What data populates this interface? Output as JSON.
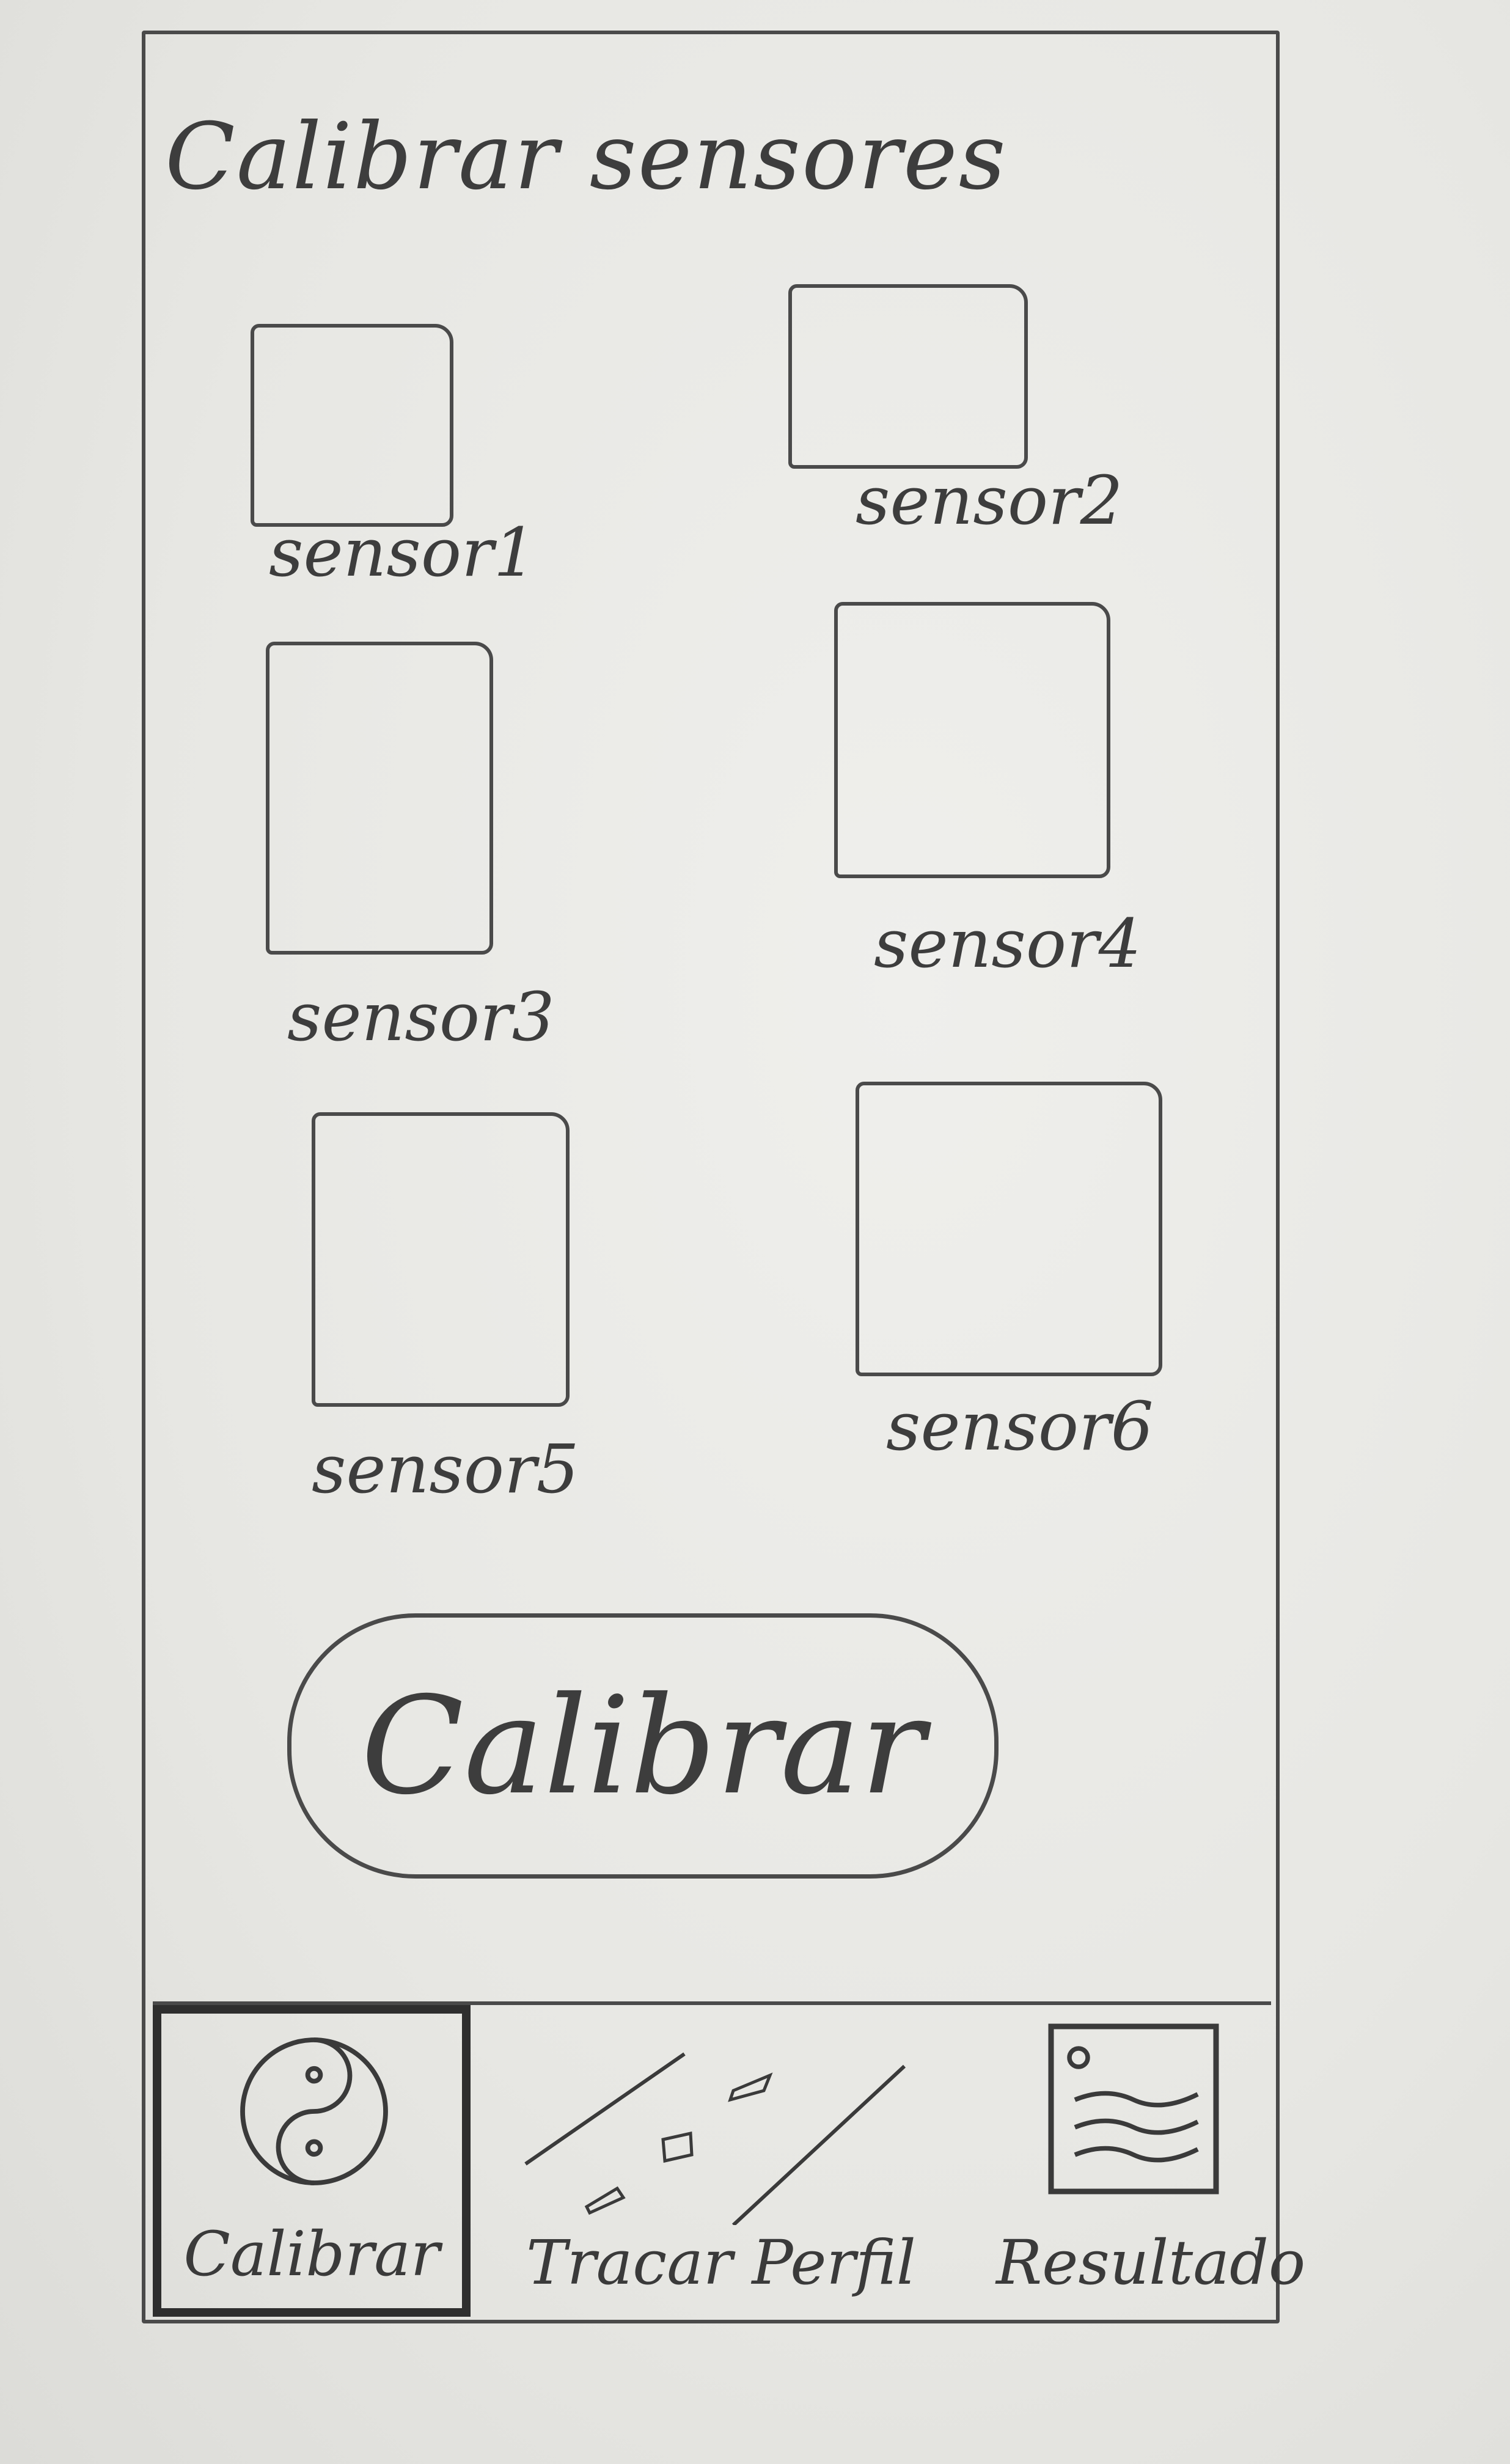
{
  "header": {
    "title": "Calibrar sensores"
  },
  "sensors": [
    {
      "label": "sensor1"
    },
    {
      "label": "sensor2"
    },
    {
      "label": "sensor3"
    },
    {
      "label": "sensor4"
    },
    {
      "label": "sensor5"
    },
    {
      "label": "sensor6"
    }
  ],
  "main": {
    "calibrate_label": "Calibrar"
  },
  "tabbar": {
    "tabs": [
      {
        "label": "Calibrar",
        "icon": "yin-yang-icon",
        "active": true
      },
      {
        "label": "Tracar Perfil",
        "icon": "road-profile-icon",
        "active": false
      },
      {
        "label": "Resultado",
        "icon": "document-image-icon",
        "active": false
      }
    ]
  },
  "colors": {
    "paper": "#ebebe8",
    "pencil": "#4a4a4a"
  }
}
